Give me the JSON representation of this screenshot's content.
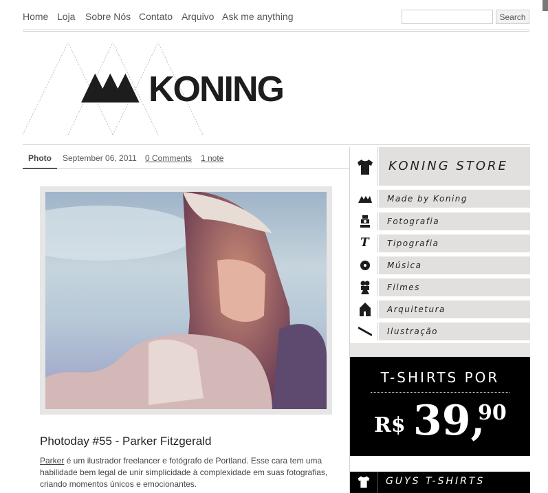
{
  "nav": {
    "items": [
      "Home",
      "Loja",
      "Sobre Nós",
      "Contato",
      "Arquivo",
      "Ask me anything"
    ],
    "search_placeholder": "",
    "search_button": "Search"
  },
  "header": {
    "logo_text": "KONING"
  },
  "post": {
    "type_tab": "Photo",
    "date": "September 06, 2011",
    "comments_link": "0 Comments",
    "notes_link": "1 note",
    "title": "Photoday #55 - Parker Fitzgerald",
    "body_link": "Parker",
    "body_text": " é um ilustrador freelancer e fotógrafo de Portland. Esse cara tem uma habilidade bem legal de unir simplicidade à complexidade em suas fotografias, criando momentos únicos e emocionantes."
  },
  "sidebar": {
    "store_title": "KONING STORE",
    "store_icon": "tshirt-icon",
    "categories": [
      {
        "label": "Made by Koning",
        "icon": "mountains-icon"
      },
      {
        "label": "Fotografia",
        "icon": "camera-icon"
      },
      {
        "label": "Tipografia",
        "icon": "type-icon"
      },
      {
        "label": "Música",
        "icon": "record-icon"
      },
      {
        "label": "Filmes",
        "icon": "film-camera-icon"
      },
      {
        "label": "Arquitetura",
        "icon": "house-icon"
      },
      {
        "label": "Ilustração",
        "icon": "pencil-icon"
      }
    ],
    "promo": {
      "line1": "T-SHIRTS POR",
      "currency": "R$",
      "price_int": "39,",
      "price_cents": "90"
    },
    "guys_label": "GUYS T-SHIRTS"
  },
  "colors": {
    "sidebar_bg": "#e2e0df",
    "promo_bg": "#000000",
    "text": "#333333"
  }
}
